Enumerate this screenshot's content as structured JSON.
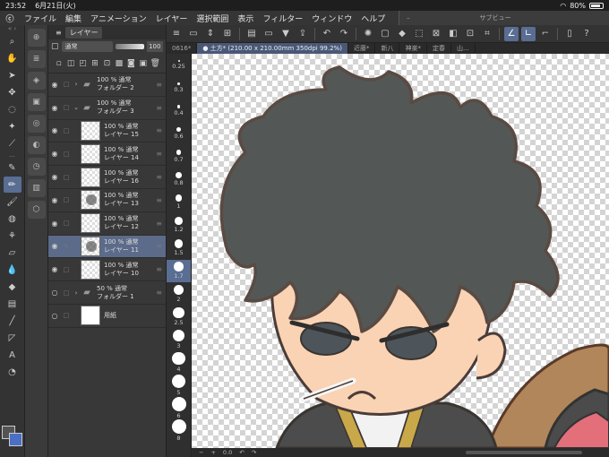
{
  "status": {
    "time": "23:52",
    "date": "6月21日(火)",
    "battery": "80%"
  },
  "menu": [
    "ファイル",
    "編集",
    "アニメーション",
    "レイヤー",
    "選択範囲",
    "表示",
    "フィルター",
    "ウィンドウ",
    "ヘルプ"
  ],
  "subview": {
    "title": "サブビュー",
    "minimize": "–"
  },
  "toolbar": {
    "icons": [
      "menu-icon",
      "undo-history-icon",
      "redo-history-icon",
      "flip-icon",
      "select-all-icon",
      "save-icon",
      "open-icon",
      "export-icon",
      "undo-icon",
      "redo-icon",
      "loading-icon",
      "transform-icon",
      "fill-icon",
      "crop-icon",
      "grid-icon",
      "rotate-icon",
      "pen-pressure-icon",
      "stabilizer-icon",
      "curve-icon",
      "tablet-icon",
      "help-icon"
    ]
  },
  "tabs": [
    "0616*",
    "● 土方* (210.00 x 210.00mm 350dpi 99.2%)",
    "近藤*",
    "新八",
    "神楽*",
    "定春",
    "山..."
  ],
  "layer_panel": {
    "tab": "レイヤー",
    "blend": "通常",
    "opacity": "100",
    "layers": [
      {
        "pct": "100 % 通常",
        "name": "フォルダー 2",
        "type": "folder",
        "expanded": false,
        "visible": true
      },
      {
        "pct": "100 % 通常",
        "name": "フォルダー 3",
        "type": "folder",
        "expanded": true,
        "visible": true
      },
      {
        "pct": "100 % 通常",
        "name": "レイヤー 15",
        "type": "layer",
        "visible": true
      },
      {
        "pct": "100 % 通常",
        "name": "レイヤー 14",
        "type": "layer",
        "visible": true
      },
      {
        "pct": "100 % 通常",
        "name": "レイヤー 16",
        "type": "layer",
        "visible": true
      },
      {
        "pct": "100 % 通常",
        "name": "レイヤー 13",
        "type": "layer",
        "visible": true
      },
      {
        "pct": "100 % 通常",
        "name": "レイヤー 12",
        "type": "layer",
        "visible": true
      },
      {
        "pct": "100 % 通常",
        "name": "レイヤー 11",
        "type": "ink",
        "visible": true,
        "active": true
      },
      {
        "pct": "100 % 通常",
        "name": "レイヤー 10",
        "type": "layer",
        "visible": true
      },
      {
        "pct": "50 % 通常",
        "name": "フォルダー 1",
        "type": "folder",
        "expanded": false,
        "visible": false
      },
      {
        "pct": "",
        "name": "用紙",
        "type": "paper",
        "visible": false
      }
    ]
  },
  "brush_sizes": [
    "0.25",
    "0.3",
    "0.4",
    "0.6",
    "0.7",
    "0.8",
    "1",
    "1.2",
    "1.5",
    "1.7",
    "2",
    "2.5",
    "3",
    "4",
    "5",
    "6",
    "8"
  ],
  "active_brush_size": "1.7",
  "bottom": {
    "zoom": "0.0"
  },
  "colors": {
    "accent": "#5a6d92",
    "foreground": "#545454",
    "background": "#4a6fc4"
  }
}
